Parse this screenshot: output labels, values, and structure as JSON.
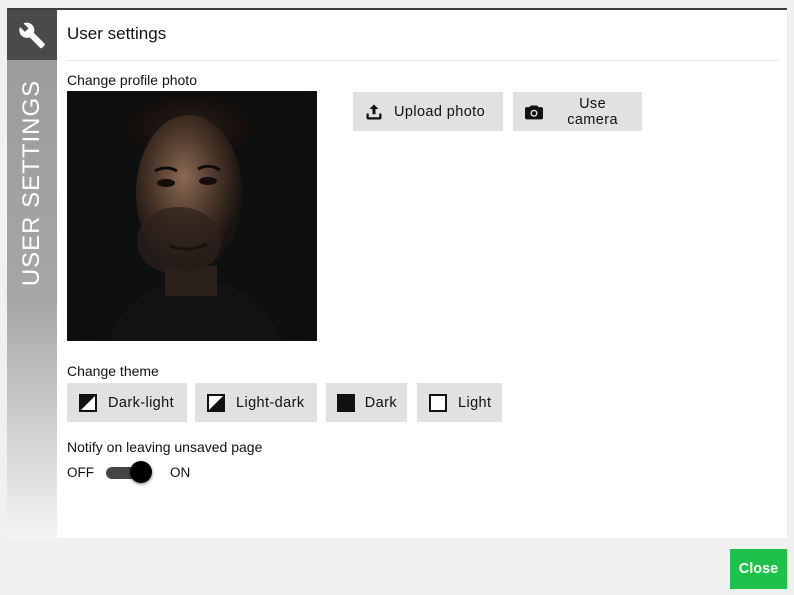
{
  "dialog": {
    "title": "User settings",
    "sidebar_label": "USER SETTINGS",
    "sidebar_icon": "wrench-icon"
  },
  "profile_photo": {
    "label": "Change profile photo",
    "upload_label": "Upload photo",
    "upload_icon": "upload-icon",
    "camera_label": "Use camera",
    "camera_icon": "camera-icon"
  },
  "theme": {
    "label": "Change theme",
    "options": [
      {
        "label": "Dark-light",
        "icon": "dark-light-theme-icon"
      },
      {
        "label": "Light-dark",
        "icon": "light-dark-theme-icon"
      },
      {
        "label": "Dark",
        "icon": "dark-theme-icon"
      },
      {
        "label": "Light",
        "icon": "light-theme-icon"
      }
    ]
  },
  "notify": {
    "label": "Notify on leaving unsaved page",
    "off_label": "OFF",
    "on_label": "ON",
    "state": "on"
  },
  "footer": {
    "close_label": "Close"
  },
  "colors": {
    "accent": "#1ec24a",
    "sidebar_dark": "#4a4a4a",
    "button_bg": "#e1e1e1"
  }
}
